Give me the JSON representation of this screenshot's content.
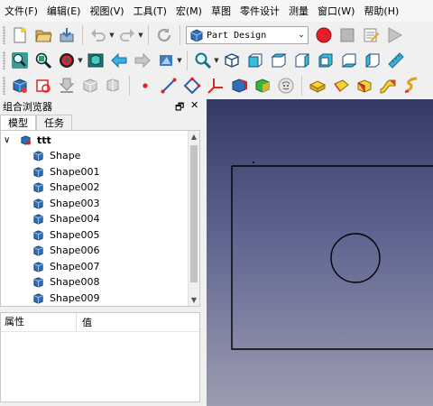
{
  "menubar": {
    "items": [
      "文件(F)",
      "编辑(E)",
      "视图(V)",
      "工具(T)",
      "宏(M)",
      "草图",
      "零件设计",
      "测量",
      "窗口(W)",
      "帮助(H)"
    ]
  },
  "toolbar": {
    "workbench_label": "Part Design",
    "icons_row1": [
      "new-file-icon",
      "open-file-icon",
      "save-icon",
      "undo-icon",
      "redo-icon",
      "refresh-icon",
      "workbench-selector",
      "record-macro-icon",
      "stop-macro-icon",
      "edit-macro-icon",
      "run-macro-icon"
    ],
    "icons_row2": [
      "fit-all-icon",
      "fit-selection-icon",
      "draw-style-icon",
      "sync-view-icon",
      "back-icon",
      "forward-icon",
      "navigation-icon",
      "zoom-icon",
      "isometric-view-icon",
      "front-view-icon",
      "top-view-icon",
      "right-view-icon",
      "rear-view-icon",
      "bottom-view-icon",
      "left-view-icon",
      "measure-icon"
    ],
    "icons_row3": [
      "create-body-icon",
      "create-sketch-icon",
      "validate-sketch-icon",
      "check-geometry-icon",
      "clone-icon",
      "datum-point-icon",
      "datum-line-icon",
      "datum-plane-icon",
      "local-cs-icon",
      "shape-binder-icon",
      "subshape-binder-icon",
      "clone-object-icon",
      "pad-icon",
      "revolution-icon",
      "additive-loft-icon",
      "additive-pipe-icon",
      "additive-helix-icon"
    ]
  },
  "combo_view": {
    "title": "组合浏览器",
    "float_btn": "🗗",
    "close_btn": "✕",
    "tabs": [
      "模型",
      "任务"
    ],
    "root": {
      "toggle": "∨",
      "label": "ttt"
    },
    "items": [
      "Shape",
      "Shape001",
      "Shape002",
      "Shape003",
      "Shape004",
      "Shape005",
      "Shape006",
      "Shape007",
      "Shape008",
      "Shape009"
    ],
    "scroll_up": "▲",
    "scroll_down": "▼"
  },
  "property_view": {
    "col_property": "属性",
    "col_value": "值"
  },
  "colors": {
    "cube_blue": "#2e6fb8",
    "viewport_top": "#333a66",
    "viewport_bottom": "#9c9cb0",
    "record_red": "#e0202a"
  }
}
